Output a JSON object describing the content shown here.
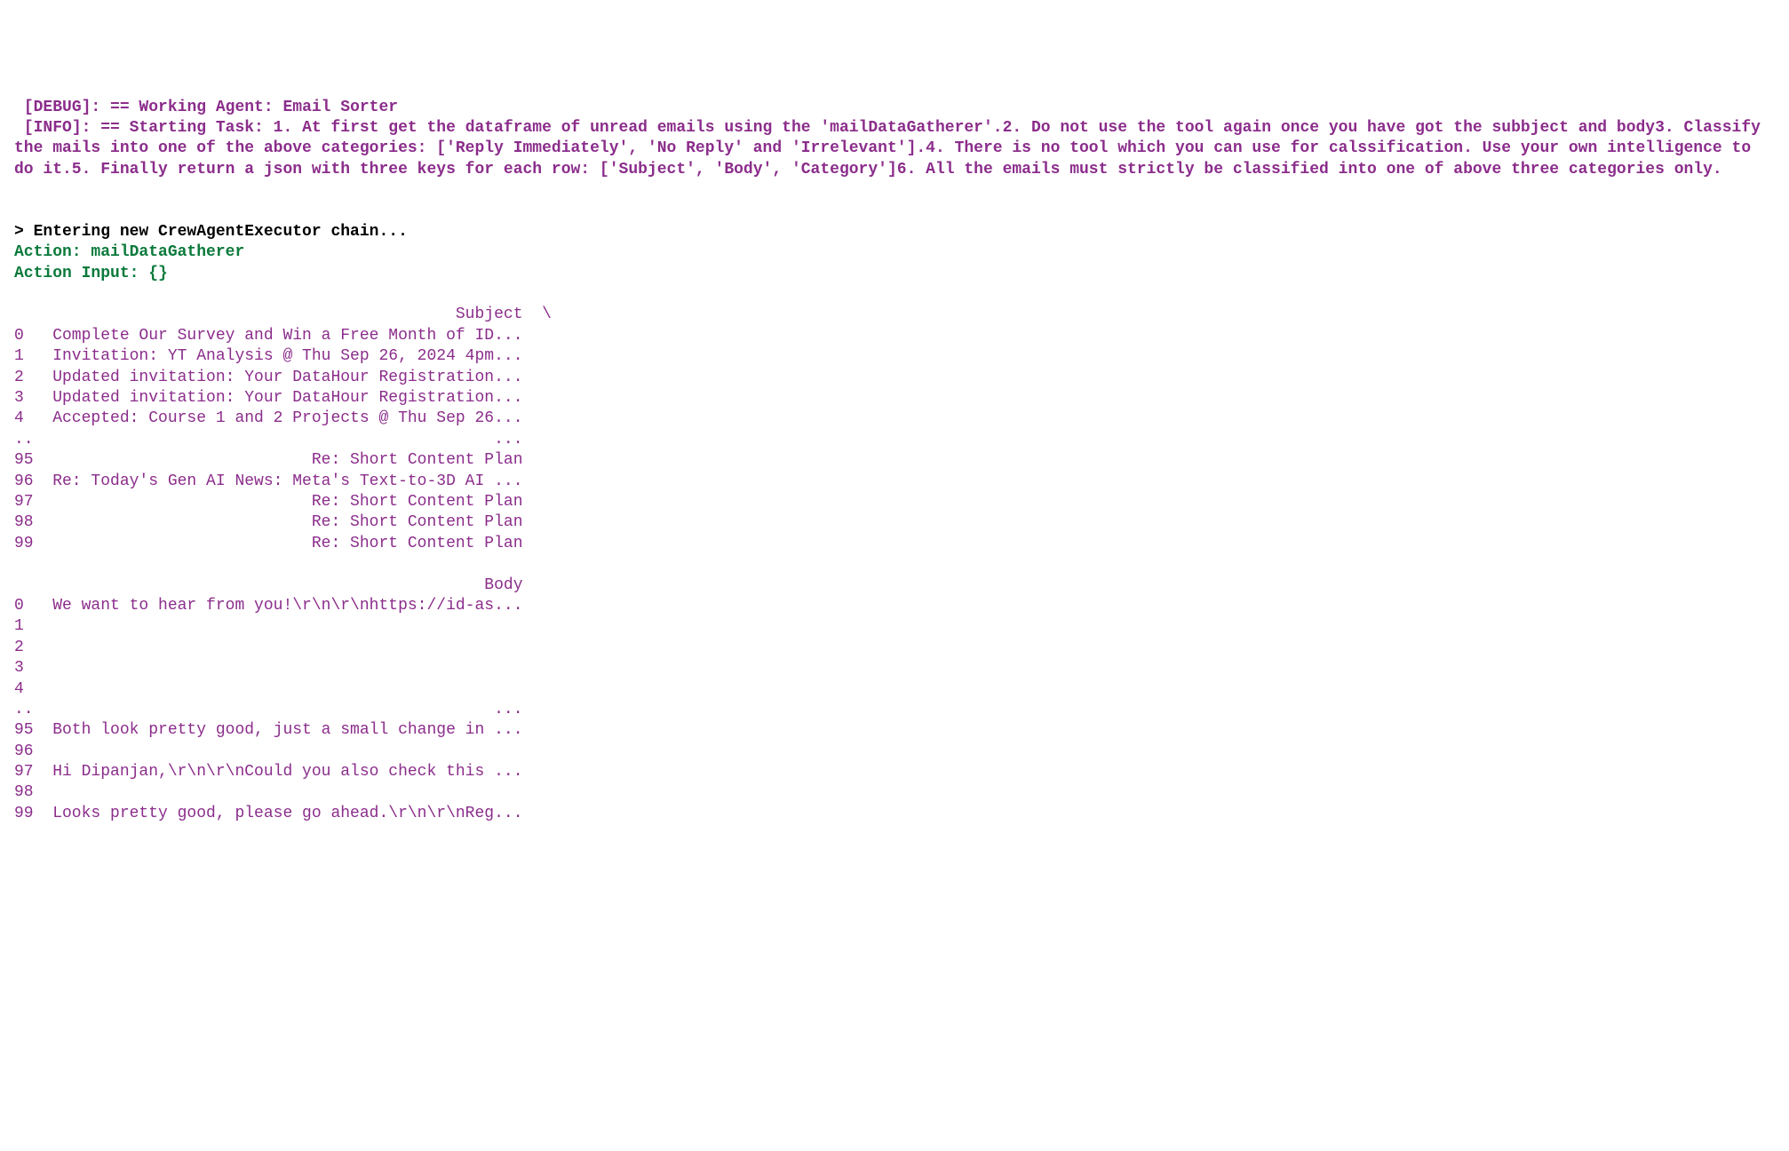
{
  "debug_line": " [DEBUG]: == Working Agent: Email Sorter",
  "info_line": " [INFO]: == Starting Task: 1. At first get the dataframe of unread emails using the 'mailDataGatherer'.2. Do not use the tool again once you have got the subbject and body3. Classify the mails into one of the above categories: ['Reply Immediately', 'No Reply' and 'Irrelevant'].4. There is no tool which you can use for calssification. Use your own intelligence to do it.5. Finally return a json with three keys for each row: ['Subject', 'Body', 'Category']6. All the emails must strictly be classified into one of above three categories only.",
  "entering_chain": "> Entering new CrewAgentExecutor chain...",
  "action_line": "Action: mailDataGatherer",
  "action_input_line": "Action Input: {}",
  "dataframe_text": "                                              Subject  \\\n0   Complete Our Survey and Win a Free Month of ID...\n1   Invitation: YT Analysis @ Thu Sep 26, 2024 4pm...\n2   Updated invitation: Your DataHour Registration...\n3   Updated invitation: Your DataHour Registration...\n4   Accepted: Course 1 and 2 Projects @ Thu Sep 26...\n..                                                ...\n95                             Re: Short Content Plan\n96  Re: Today's Gen AI News: Meta's Text-to-3D AI ...\n97                             Re: Short Content Plan\n98                             Re: Short Content Plan\n99                             Re: Short Content Plan\n\n                                                 Body\n0   We want to hear from you!\\r\\n\\r\\nhttps://id-as...\n1\n2\n3\n4\n..                                                ...\n95  Both look pretty good, just a small change in ...\n96\n97  Hi Dipanjan,\\r\\n\\r\\nCould you also check this ...\n98\n99  Looks pretty good, please go ahead.\\r\\n\\r\\nReg..."
}
